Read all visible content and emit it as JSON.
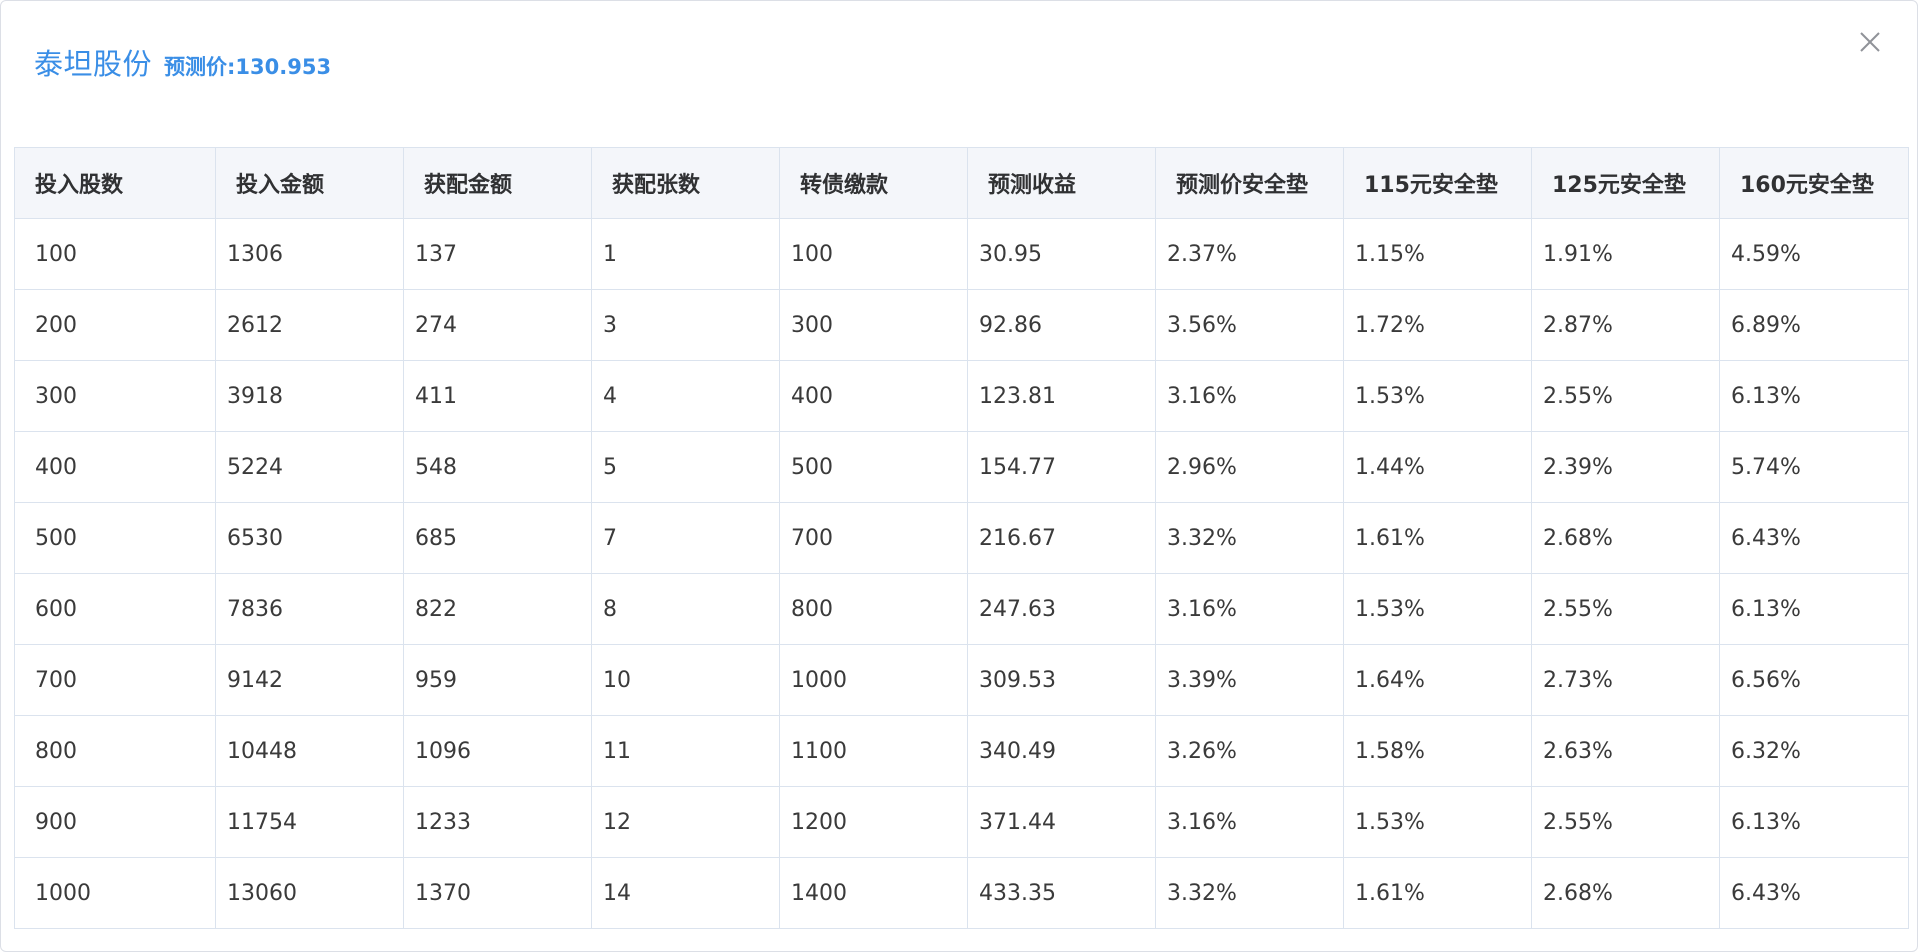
{
  "dialog": {
    "title": "泰坦股份",
    "subtitle": "预测价:130.953",
    "close_icon": "close-icon"
  },
  "table": {
    "columns": [
      "投入股数",
      "投入金额",
      "获配金额",
      "获配张数",
      "转债缴款",
      "预测收益",
      "预测价安全垫",
      "115元安全垫",
      "125元安全垫",
      "160元安全垫"
    ],
    "rows": [
      [
        "100",
        "1306",
        "137",
        "1",
        "100",
        "30.95",
        "2.37%",
        "1.15%",
        "1.91%",
        "4.59%"
      ],
      [
        "200",
        "2612",
        "274",
        "3",
        "300",
        "92.86",
        "3.56%",
        "1.72%",
        "2.87%",
        "6.89%"
      ],
      [
        "300",
        "3918",
        "411",
        "4",
        "400",
        "123.81",
        "3.16%",
        "1.53%",
        "2.55%",
        "6.13%"
      ],
      [
        "400",
        "5224",
        "548",
        "5",
        "500",
        "154.77",
        "2.96%",
        "1.44%",
        "2.39%",
        "5.74%"
      ],
      [
        "500",
        "6530",
        "685",
        "7",
        "700",
        "216.67",
        "3.32%",
        "1.61%",
        "2.68%",
        "6.43%"
      ],
      [
        "600",
        "7836",
        "822",
        "8",
        "800",
        "247.63",
        "3.16%",
        "1.53%",
        "2.55%",
        "6.13%"
      ],
      [
        "700",
        "9142",
        "959",
        "10",
        "1000",
        "309.53",
        "3.39%",
        "1.64%",
        "2.73%",
        "6.56%"
      ],
      [
        "800",
        "10448",
        "1096",
        "11",
        "1100",
        "340.49",
        "3.26%",
        "1.58%",
        "2.63%",
        "6.32%"
      ],
      [
        "900",
        "11754",
        "1233",
        "12",
        "1200",
        "371.44",
        "3.16%",
        "1.53%",
        "2.55%",
        "6.13%"
      ],
      [
        "1000",
        "13060",
        "1370",
        "14",
        "1400",
        "433.35",
        "3.32%",
        "1.61%",
        "2.68%",
        "6.43%"
      ]
    ]
  },
  "colors": {
    "accent": "#3a8ee6",
    "header_bg": "#f4f6fa",
    "border": "#dbe3ee",
    "text": "#3a3a3a"
  }
}
